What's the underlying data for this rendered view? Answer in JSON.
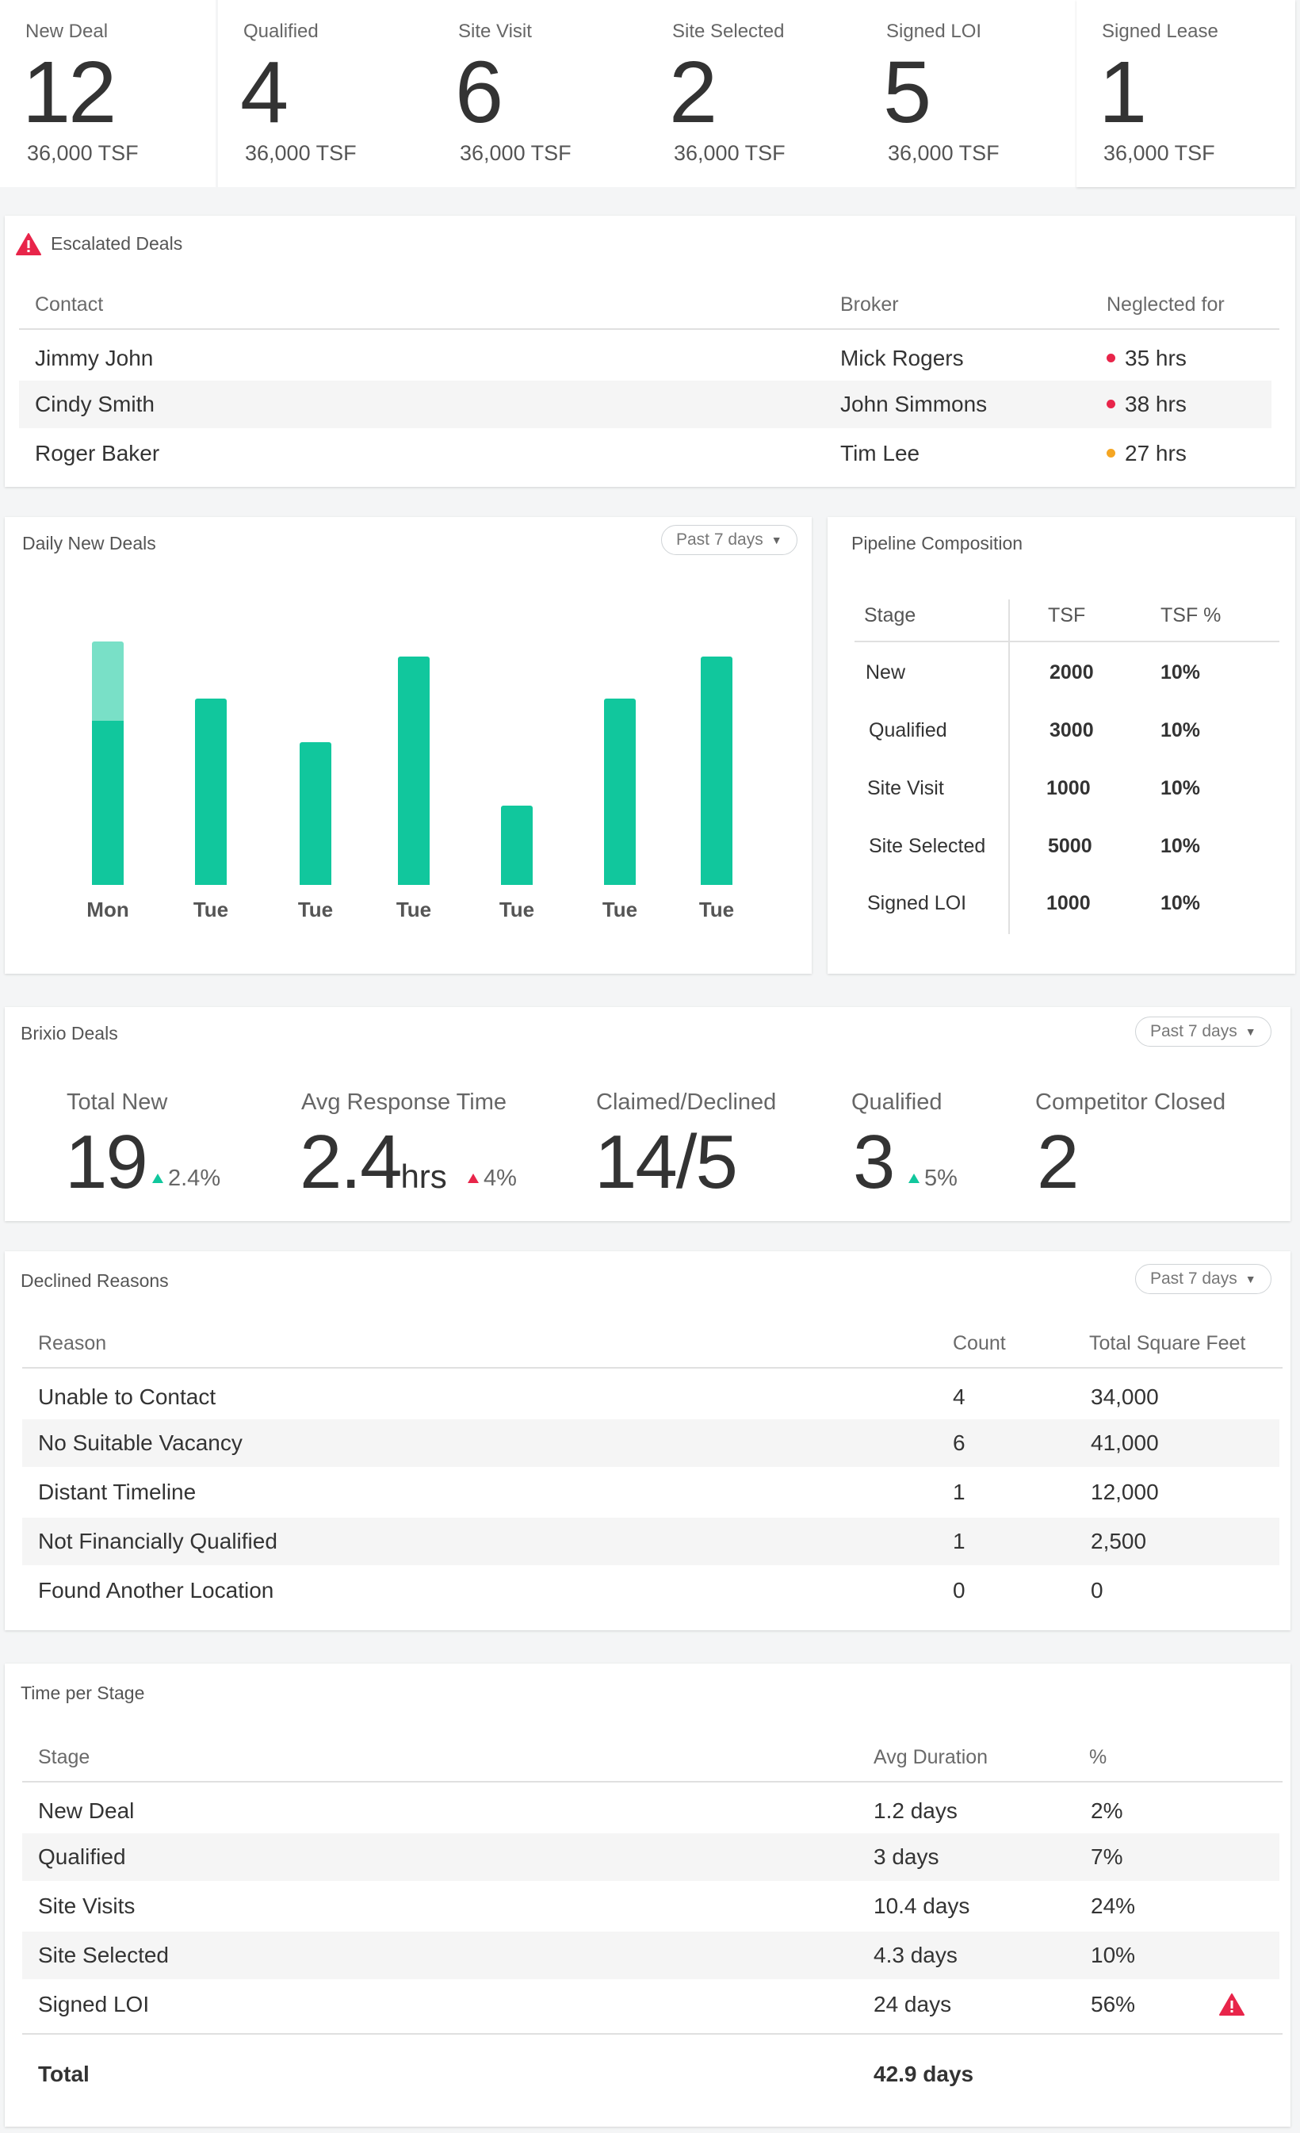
{
  "stats": [
    {
      "label": "New Deal",
      "value": "12",
      "sub": "36,000 TSF"
    },
    {
      "label": "Qualified",
      "value": "4",
      "sub": "36,000 TSF"
    },
    {
      "label": "Site Visit",
      "value": "6",
      "sub": "36,000 TSF"
    },
    {
      "label": "Site Selected",
      "value": "2",
      "sub": "36,000 TSF"
    },
    {
      "label": "Signed LOI",
      "value": "5",
      "sub": "36,000 TSF"
    },
    {
      "label": "Signed Lease",
      "value": "1",
      "sub": "36,000 TSF"
    }
  ],
  "escalated": {
    "title": "Escalated Deals",
    "headers": [
      "Contact",
      "Broker",
      "Neglected for"
    ],
    "rows": [
      {
        "contact": "Jimmy John",
        "broker": "Mick Rogers",
        "neglected": "35 hrs",
        "level": "high"
      },
      {
        "contact": "Cindy Smith",
        "broker": "John Simmons",
        "neglected": "38 hrs",
        "level": "high"
      },
      {
        "contact": "Roger Baker",
        "broker": "Tim Lee",
        "neglected": "27 hrs",
        "level": "medium"
      }
    ],
    "colors": {
      "high": "#e8254a",
      "medium": "#f5a623"
    }
  },
  "daily": {
    "title": "Daily New Deals",
    "range_label": "Past 7 days"
  },
  "chart_data": {
    "type": "bar",
    "categories": [
      "Mon",
      "Tue",
      "Tue",
      "Tue",
      "Tue",
      "Tue",
      "Tue"
    ],
    "series": [
      {
        "values": [
          207,
          235,
          180,
          288,
          100,
          235,
          288
        ]
      },
      {
        "values": [
          100,
          0,
          0,
          0,
          0,
          0,
          0
        ]
      }
    ],
    "colors": [
      "#11c79d",
      "#79e0c7"
    ],
    "ylim": [
      0,
      320
    ]
  },
  "pipeline": {
    "title": "Pipeline Composition",
    "headers": [
      "Stage",
      "TSF",
      "TSF %"
    ],
    "rows": [
      {
        "stage": "New",
        "tsf": "2000",
        "pct": "10%"
      },
      {
        "stage": "Qualified",
        "tsf": "3000",
        "pct": "10%"
      },
      {
        "stage": "Site Visit",
        "tsf": "1000",
        "pct": "10%"
      },
      {
        "stage": "Site Selected",
        "tsf": "5000",
        "pct": "10%"
      },
      {
        "stage": "Signed LOI",
        "tsf": "1000",
        "pct": "10%"
      }
    ]
  },
  "brixio": {
    "title": "Brixio Deals",
    "range_label": "Past 7 days",
    "kpis": [
      {
        "label": "Total New",
        "value": "19",
        "unit": "",
        "delta": "2.4%",
        "trend": "up-good"
      },
      {
        "label": "Avg Response Time",
        "value": "2.4",
        "unit": "hrs",
        "delta": "4%",
        "trend": "up-bad"
      },
      {
        "label": "Claimed/Declined",
        "value": "14/5",
        "unit": "",
        "delta": "",
        "trend": ""
      },
      {
        "label": "Qualified",
        "value": "3",
        "unit": "",
        "delta": "5%",
        "trend": "up-good"
      },
      {
        "label": "Competitor Closed",
        "value": "2",
        "unit": "",
        "delta": "",
        "trend": ""
      }
    ]
  },
  "declined": {
    "title": "Declined Reasons",
    "range_label": "Past 7 days",
    "headers": [
      "Reason",
      "Count",
      "Total Square Feet"
    ],
    "rows": [
      {
        "reason": "Unable to Contact",
        "count": "4",
        "tsf": "34,000"
      },
      {
        "reason": "No Suitable Vacancy",
        "count": "6",
        "tsf": "41,000"
      },
      {
        "reason": "Distant Timeline",
        "count": "1",
        "tsf": "12,000"
      },
      {
        "reason": "Not Financially Qualified",
        "count": "1",
        "tsf": "2,500"
      },
      {
        "reason": "Found Another Location",
        "count": "0",
        "tsf": "0"
      }
    ]
  },
  "time_per_stage": {
    "title": "Time per Stage",
    "headers": [
      "Stage",
      "Avg Duration",
      "%"
    ],
    "rows": [
      {
        "stage": "New Deal",
        "duration": "1.2 days",
        "pct": "2%",
        "warn": false
      },
      {
        "stage": "Qualified",
        "duration": "3 days",
        "pct": "7%",
        "warn": false
      },
      {
        "stage": "Site Visits",
        "duration": "10.4 days",
        "pct": "24%",
        "warn": false
      },
      {
        "stage": "Site Selected",
        "duration": "4.3 days",
        "pct": "10%",
        "warn": false
      },
      {
        "stage": "Signed LOI",
        "duration": "24 days",
        "pct": "56%",
        "warn": true
      }
    ],
    "total_label": "Total",
    "total_value": "42.9 days"
  },
  "icons": {
    "warning": "warning-icon",
    "caret": "caret-down-icon",
    "trend_up": "triangle-up-icon"
  },
  "accent_colors": {
    "green": "#11c79d",
    "red": "#e8254a",
    "orange": "#f5a623"
  }
}
